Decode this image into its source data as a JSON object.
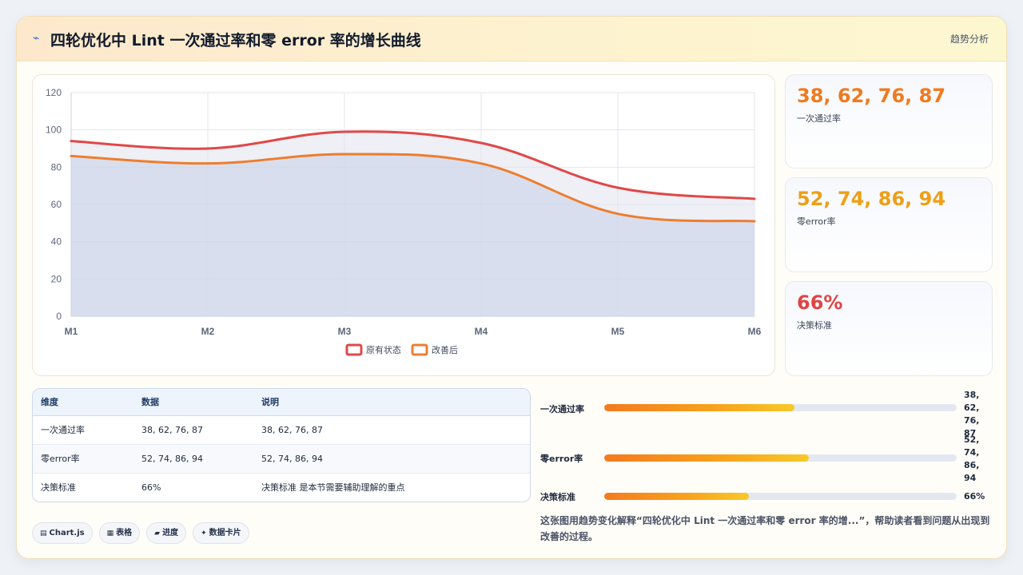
{
  "header": {
    "icon": "trend-line-icon",
    "title": "四轮优化中 Lint 一次通过率和零 error 率的增长曲线",
    "tag": "趋势分析"
  },
  "chart_data": {
    "type": "area",
    "categories": [
      "M1",
      "M2",
      "M3",
      "M4",
      "M5",
      "M6"
    ],
    "ylim": [
      0,
      120
    ],
    "yticks": [
      0,
      20,
      40,
      60,
      80,
      100,
      120
    ],
    "grid": true,
    "legend_position": "bottom-center",
    "series": [
      {
        "name": "原有状态",
        "values": [
          94,
          90,
          99,
          93,
          69,
          63
        ],
        "color": "#e04848",
        "fill": "rgba(225, 225, 238, 0.55)"
      },
      {
        "name": "改善后",
        "values": [
          86,
          82,
          87,
          82,
          55,
          51
        ],
        "color": "#ee7d2e",
        "fill": "rgba(196, 208, 229, 0.55)"
      }
    ]
  },
  "stats": [
    {
      "value": "38, 62, 76, 87",
      "label": "一次通过率",
      "color": "#f07a1e"
    },
    {
      "value": "52, 74, 86, 94",
      "label": "零error率",
      "color": "#ee9f16"
    },
    {
      "value": "66%",
      "label": "决策标准",
      "color": "#e04444"
    }
  ],
  "table": {
    "headers": [
      "维度",
      "数据",
      "说明"
    ],
    "rows": [
      [
        "一次通过率",
        "38, 62, 76, 87",
        "38, 62, 76, 87"
      ],
      [
        "零error率",
        "52, 74, 86, 94",
        "52, 74, 86, 94"
      ],
      [
        "决策标准",
        "66%",
        "决策标准 是本节需要辅助理解的重点"
      ]
    ]
  },
  "chips": [
    {
      "icon": "chartjs-icon",
      "glyph": "▤",
      "label": "Chart.js"
    },
    {
      "icon": "table-icon",
      "glyph": "▦",
      "label": "表格"
    },
    {
      "icon": "progress-icon",
      "glyph": "▰",
      "label": "进度"
    },
    {
      "icon": "data-card-icon",
      "glyph": "✦",
      "label": "数据卡片"
    }
  ],
  "progress": [
    {
      "label": "一次通过率",
      "value": "38,\n62,\n76,\n87",
      "fraction": 0.54
    },
    {
      "label": "零error率",
      "value": "52,\n74,\n86,\n94",
      "fraction": 0.58
    },
    {
      "label": "决策标准",
      "value": "66%",
      "fraction": 0.41
    }
  ],
  "summary": "这张图用趋势变化解释“四轮优化中 Lint 一次通过率和零 error 率的增...”，帮助读者看到问题从出现到改善的过程。"
}
